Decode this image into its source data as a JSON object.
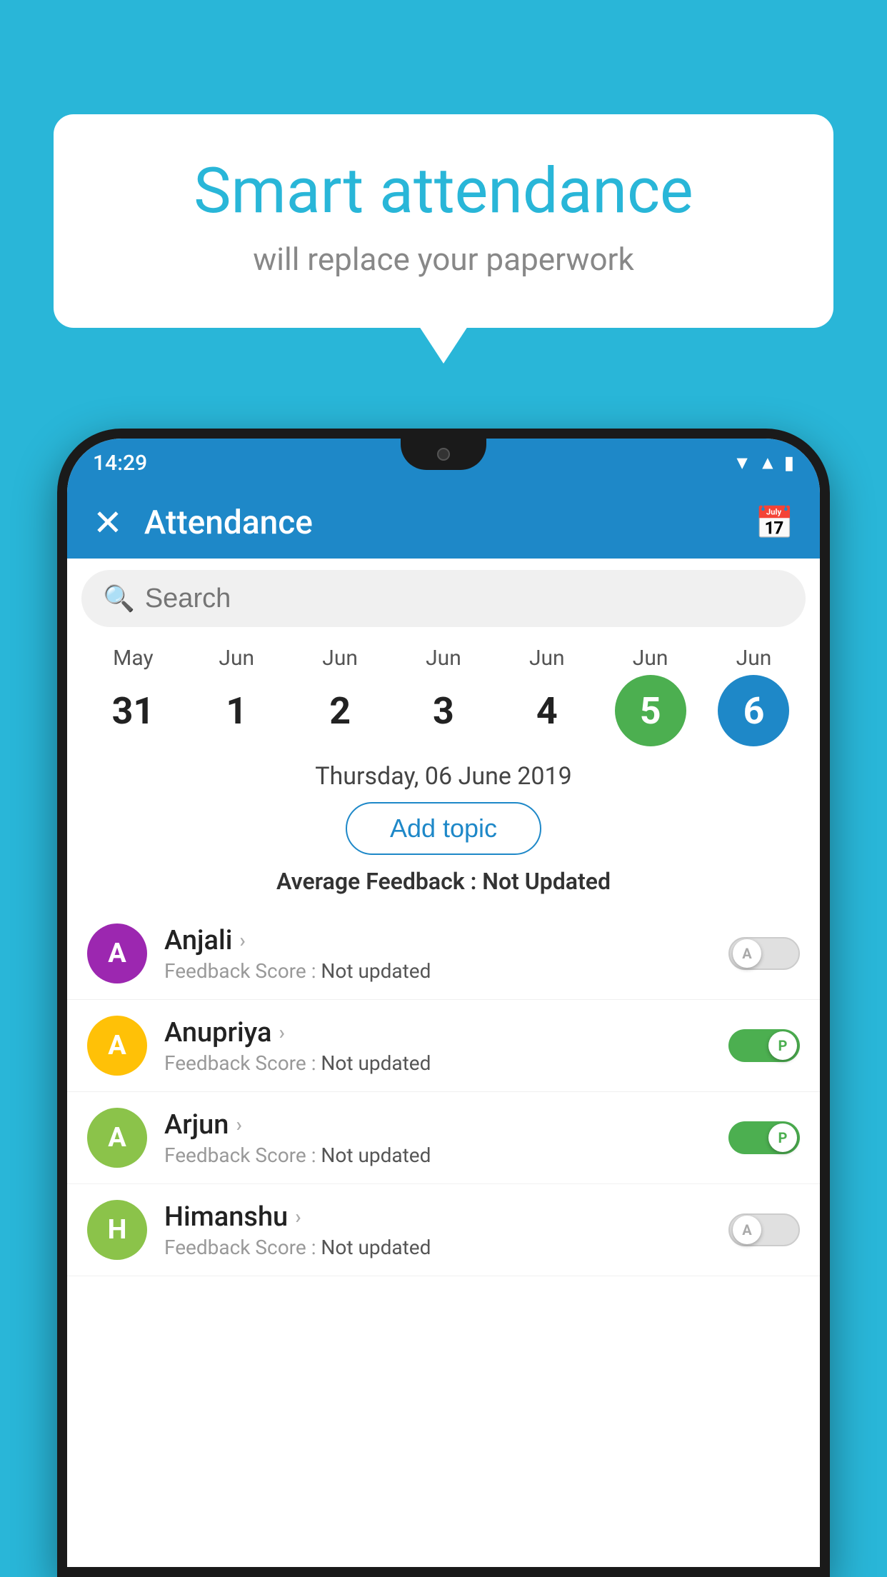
{
  "background_color": "#29b6d8",
  "speech_bubble": {
    "heading": "Smart attendance",
    "subtext": "will replace your paperwork"
  },
  "status_bar": {
    "time": "14:29",
    "wifi": "wifi",
    "signal": "signal",
    "battery": "battery"
  },
  "app_bar": {
    "title": "Attendance",
    "close_label": "×",
    "calendar_icon": "calendar"
  },
  "search": {
    "placeholder": "Search"
  },
  "dates": [
    {
      "month": "May",
      "day": "31",
      "state": "normal"
    },
    {
      "month": "Jun",
      "day": "1",
      "state": "normal"
    },
    {
      "month": "Jun",
      "day": "2",
      "state": "normal"
    },
    {
      "month": "Jun",
      "day": "3",
      "state": "normal"
    },
    {
      "month": "Jun",
      "day": "4",
      "state": "normal"
    },
    {
      "month": "Jun",
      "day": "5",
      "state": "today"
    },
    {
      "month": "Jun",
      "day": "6",
      "state": "selected"
    }
  ],
  "selected_date_label": "Thursday, 06 June 2019",
  "add_topic_label": "Add topic",
  "avg_feedback_label": "Average Feedback :",
  "avg_feedback_value": "Not Updated",
  "students": [
    {
      "name": "Anjali",
      "initial": "A",
      "avatar_color": "#9c27b0",
      "feedback_label": "Feedback Score :",
      "feedback_value": "Not updated",
      "attendance": "A",
      "present": false
    },
    {
      "name": "Anupriya",
      "initial": "A",
      "avatar_color": "#ffc107",
      "feedback_label": "Feedback Score :",
      "feedback_value": "Not updated",
      "attendance": "P",
      "present": true
    },
    {
      "name": "Arjun",
      "initial": "A",
      "avatar_color": "#8bc34a",
      "feedback_label": "Feedback Score :",
      "feedback_value": "Not updated",
      "attendance": "P",
      "present": true
    },
    {
      "name": "Himanshu",
      "initial": "H",
      "avatar_color": "#8bc34a",
      "feedback_label": "Feedback Score :",
      "feedback_value": "Not updated",
      "attendance": "A",
      "present": false
    }
  ]
}
